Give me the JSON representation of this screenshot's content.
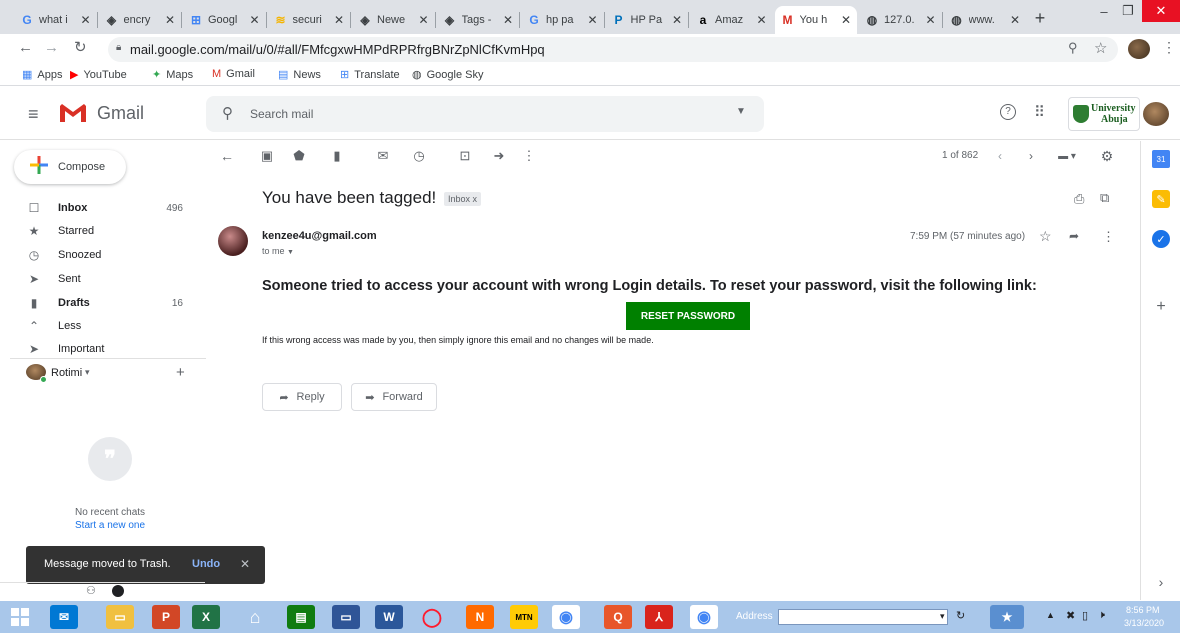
{
  "browser": {
    "tabs": [
      {
        "icon": "G",
        "label": "what i",
        "color": "#4285f4"
      },
      {
        "icon": "◈",
        "label": "encry",
        "color": "#3c4043"
      },
      {
        "icon": "⊞",
        "label": "Googl",
        "color": "#4285f4"
      },
      {
        "icon": "≋",
        "label": "securi",
        "color": "#f4b400"
      },
      {
        "icon": "◈",
        "label": "Newe",
        "color": "#3c4043"
      },
      {
        "icon": "◈",
        "label": "Tags -",
        "color": "#3c4043"
      },
      {
        "icon": "G",
        "label": "hp pa",
        "color": "#4285f4"
      },
      {
        "icon": "P",
        "label": "HP Pa",
        "color": "#0070ba"
      },
      {
        "icon": "a",
        "label": "Amaz",
        "color": "#000000"
      },
      {
        "icon": "M",
        "label": "You h",
        "color": "#d93025"
      },
      {
        "icon": "◍",
        "label": "127.0.",
        "color": "#3c4043"
      },
      {
        "icon": "◍",
        "label": "www.",
        "color": "#3c4043"
      }
    ],
    "tab_close": "✕",
    "new_tab": "+",
    "url": "mail.google.com/mail/u/0/#all/FMfcgxwHMPdRPRfrgBNrZpNlCfKvmHpq",
    "bookmarks": [
      {
        "icon": "▦",
        "label": "Apps",
        "color": "#4285f4"
      },
      {
        "icon": "▶",
        "label": "YouTube",
        "color": "#ff0000"
      },
      {
        "icon": "✦",
        "label": "Maps",
        "color": "#34a853"
      },
      {
        "icon": "M",
        "label": "Gmail",
        "color": "#d93025"
      },
      {
        "icon": "▤",
        "label": "News",
        "color": "#4285f4"
      },
      {
        "icon": "⊞",
        "label": "Translate",
        "color": "#4285f4"
      },
      {
        "icon": "◍",
        "label": "Google Sky",
        "color": "#3c4043"
      }
    ]
  },
  "gmail": {
    "logo_text": "Gmail",
    "search_placeholder": "Search mail",
    "org_logo_text_1": "University",
    "org_logo_text_2": "Abuja",
    "compose_label": "Compose",
    "nav": [
      {
        "icon": "☐",
        "label": "Inbox",
        "count": "496",
        "bold": true
      },
      {
        "icon": "★",
        "label": "Starred",
        "count": "",
        "bold": false
      },
      {
        "icon": "◷",
        "label": "Snoozed",
        "count": "",
        "bold": false
      },
      {
        "icon": "➤",
        "label": "Sent",
        "count": "",
        "bold": false
      },
      {
        "icon": "▮",
        "label": "Drafts",
        "count": "16",
        "bold": true
      },
      {
        "icon": "⌃",
        "label": "Less",
        "count": "",
        "bold": false
      },
      {
        "icon": "➤",
        "label": "Important",
        "count": "",
        "bold": false
      }
    ],
    "chat_user": "Rotimi",
    "chat_user_caret": "▾",
    "chat_add": "+",
    "no_chats": "No recent chats",
    "start_chat": "Start a new one",
    "pagination": "1 of 862",
    "email": {
      "subject": "You have been tagged!",
      "label_chip": "Inbox",
      "sender": "kenzee4u@gmail.com",
      "to": "to me",
      "time": "7:59 PM (57 minutes ago)",
      "headline": "Someone tried to access your account with wrong Login details. To reset your password, visit the following link:",
      "button": "RESET PASSWORD",
      "footer": "If this wrong access was made by you, then simply ignore this email and no changes will be made.",
      "reply": "Reply",
      "forward": "Forward"
    },
    "toast": {
      "message": "Message moved to Trash.",
      "action": "Undo",
      "close": "✕"
    }
  },
  "taskbar": {
    "address_label": "Address",
    "time": "8:56 PM",
    "date": "3/13/2020"
  }
}
